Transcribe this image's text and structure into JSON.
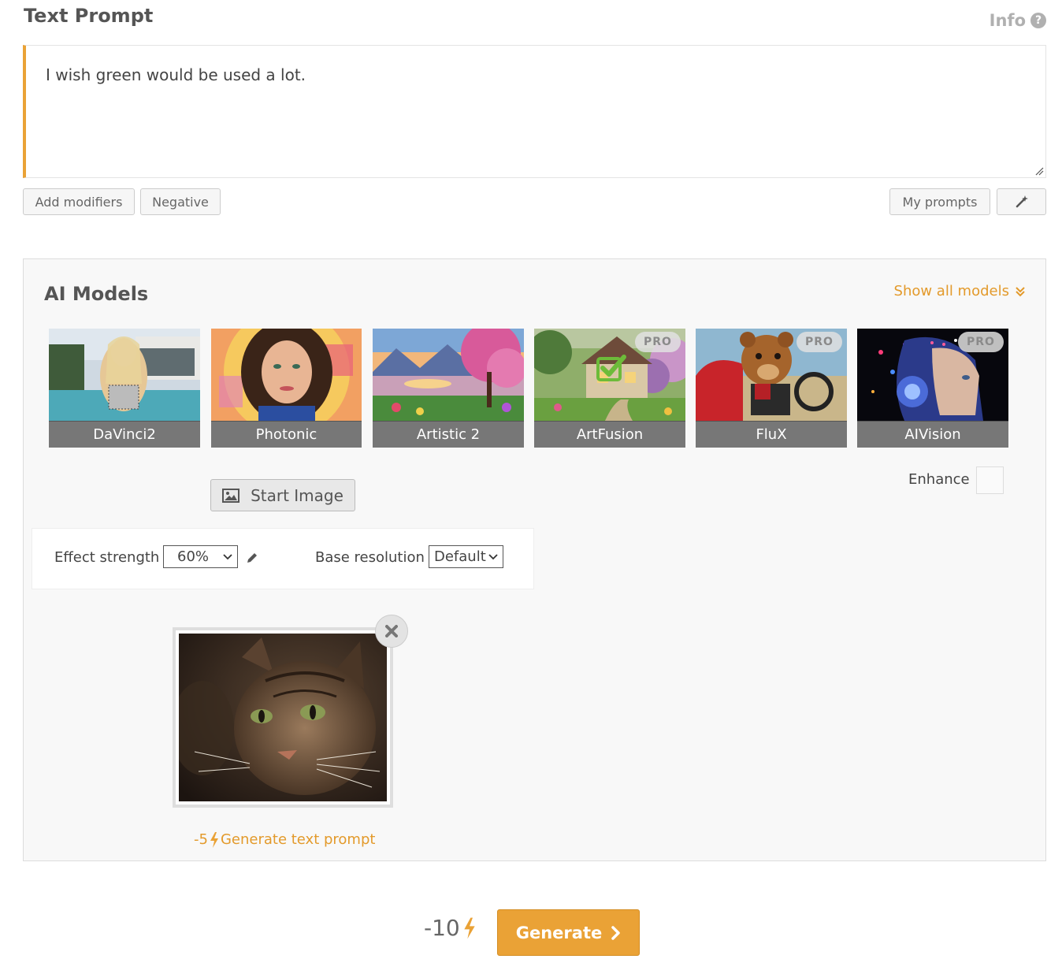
{
  "header": {
    "title": "Text Prompt",
    "info_label": "Info"
  },
  "prompt": {
    "value": "I wish green would be used a lot."
  },
  "prompt_actions": {
    "add_modifiers": "Add modifiers",
    "negative": "Negative",
    "my_prompts": "My prompts"
  },
  "models": {
    "title": "AI Models",
    "show_all": "Show all models",
    "items": [
      {
        "name": "DaVinci2",
        "pro": false,
        "selected": false
      },
      {
        "name": "Photonic",
        "pro": false,
        "selected": false
      },
      {
        "name": "Artistic 2",
        "pro": false,
        "selected": false
      },
      {
        "name": "ArtFusion",
        "pro": true,
        "pro_label": "PRO",
        "selected": true
      },
      {
        "name": "FluX",
        "pro": true,
        "pro_label": "PRO",
        "selected": false
      },
      {
        "name": "AIVision",
        "pro": true,
        "pro_label": "PRO",
        "selected": false
      }
    ]
  },
  "start_image": {
    "label": "Start Image"
  },
  "enhance": {
    "label": "Enhance",
    "checked": false
  },
  "settings": {
    "effect_strength_label": "Effect strength",
    "effect_strength_value": "60%",
    "base_resolution_label": "Base resolution",
    "base_resolution_value": "Default"
  },
  "uploaded_image": {
    "description_icon": "cat-photo"
  },
  "generate_text_prompt": {
    "cost": "-5",
    "label": "Generate text prompt"
  },
  "footer": {
    "cost": "-10",
    "generate_label": "Generate"
  },
  "colors": {
    "accent": "#eaa236",
    "link": "#e39a2b",
    "check": "#6dbb3a"
  }
}
